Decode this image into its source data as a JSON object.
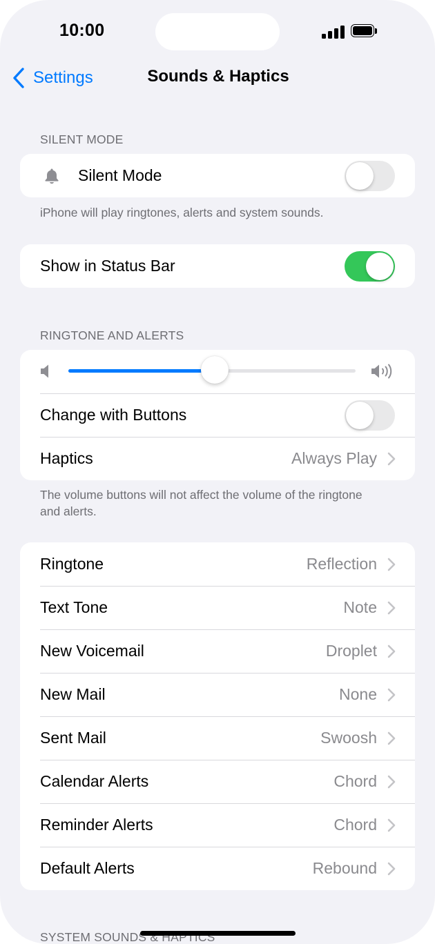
{
  "status_bar": {
    "time": "10:00"
  },
  "nav": {
    "back_label": "Settings",
    "title": "Sounds & Haptics"
  },
  "silent_section": {
    "header": "SILENT MODE",
    "silent_mode": {
      "label": "Silent Mode",
      "on": false,
      "icon": "bell-icon"
    },
    "footer": "iPhone will play ringtones, alerts and system sounds."
  },
  "status_bar_section": {
    "show_in_status_bar": {
      "label": "Show in Status Bar",
      "on": true
    }
  },
  "ringtone_section": {
    "header": "RINGTONE AND ALERTS",
    "volume_level": 0.51,
    "change_with_buttons": {
      "label": "Change with Buttons",
      "on": false
    },
    "haptics": {
      "label": "Haptics",
      "value": "Always Play"
    },
    "footer": "The volume buttons will not affect the volume of the ringtone and alerts."
  },
  "tones": [
    {
      "label": "Ringtone",
      "value": "Reflection"
    },
    {
      "label": "Text Tone",
      "value": "Note"
    },
    {
      "label": "New Voicemail",
      "value": "Droplet"
    },
    {
      "label": "New Mail",
      "value": "None"
    },
    {
      "label": "Sent Mail",
      "value": "Swoosh"
    },
    {
      "label": "Calendar Alerts",
      "value": "Chord"
    },
    {
      "label": "Reminder Alerts",
      "value": "Chord"
    },
    {
      "label": "Default Alerts",
      "value": "Rebound"
    }
  ],
  "system_section": {
    "header": "SYSTEM SOUNDS & HAPTICS"
  },
  "colors": {
    "accent": "#007aff",
    "toggle_on": "#34c759",
    "background": "#f2f2f7"
  }
}
